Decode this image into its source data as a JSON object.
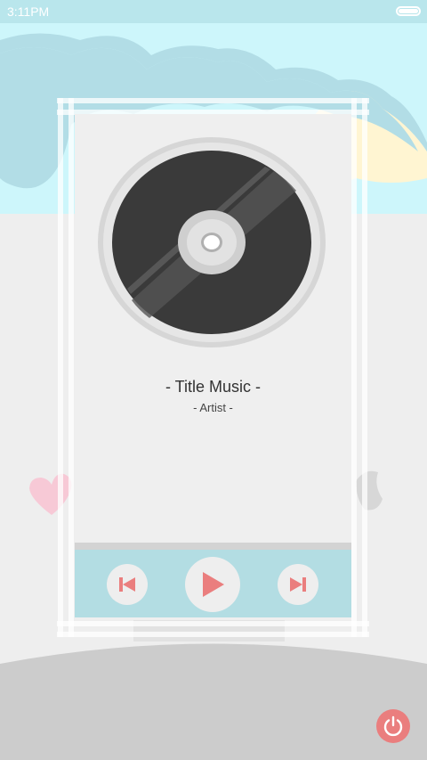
{
  "status_bar": {
    "time": "3:11PM",
    "battery_icon": "battery-icon"
  },
  "player": {
    "title": "- Title Music -",
    "artist": "- Artist -",
    "disc_icon": "vinyl-record-icon",
    "controls": {
      "previous_icon": "skip-previous-icon",
      "play_icon": "play-icon",
      "next_icon": "skip-next-icon"
    }
  },
  "power_icon": "power-icon",
  "colors": {
    "accent": "#ea7e7e",
    "control_bar": "#b3dde3",
    "sky": "#cdf6fb",
    "cloud": "#b2dde6",
    "ground": "#cccccc",
    "card": "#efefef",
    "status_bar": "#b9e6ec"
  }
}
